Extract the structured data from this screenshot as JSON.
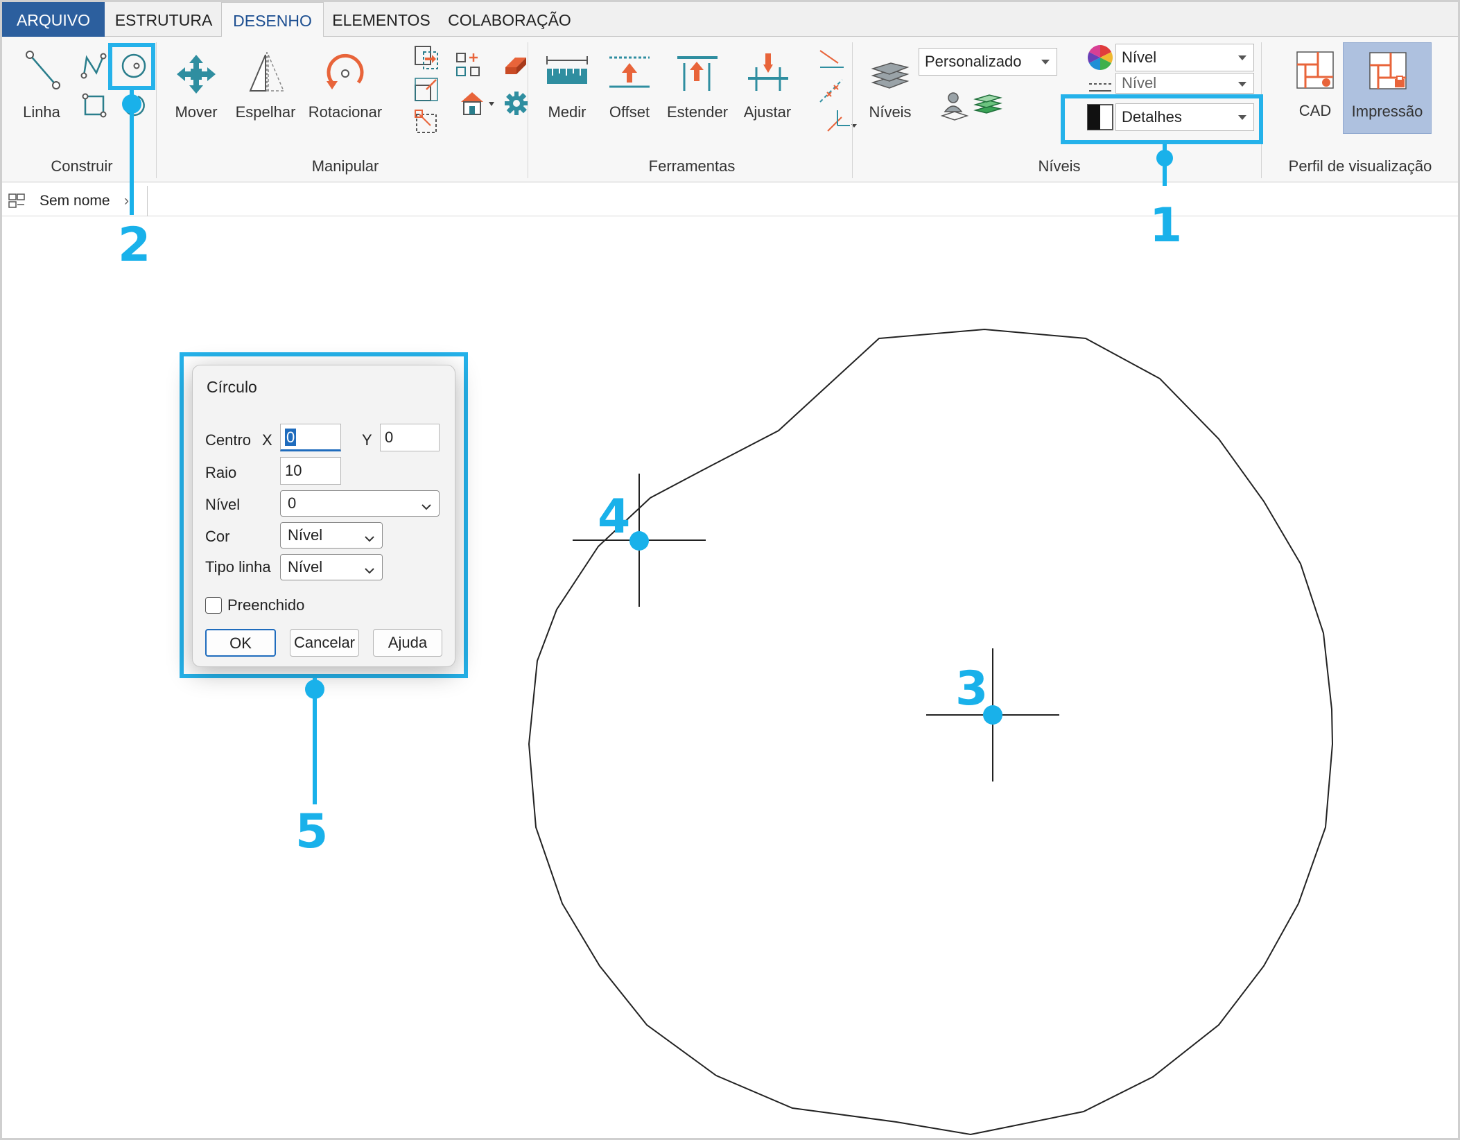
{
  "menu": {
    "tabs": [
      {
        "label": "ARQUIVO"
      },
      {
        "label": "ESTRUTURA"
      },
      {
        "label": "DESENHO"
      },
      {
        "label": "ELEMENTOS"
      },
      {
        "label": "COLABORAÇÃO"
      }
    ],
    "active_tab": "DESENHO"
  },
  "ribbon": {
    "groups": {
      "construir": {
        "title": "Construir",
        "buttons": [
          {
            "label": "Linha",
            "icon": "line-icon"
          },
          {
            "icon": "polyline-icon"
          },
          {
            "icon": "circle-icon"
          },
          {
            "icon": "rectangle-icon"
          },
          {
            "icon": "arc-icon"
          }
        ]
      },
      "manipular": {
        "title": "Manipular",
        "buttons": [
          {
            "label": "Mover",
            "icon": "move-icon"
          },
          {
            "label": "Espelhar",
            "icon": "mirror-icon"
          },
          {
            "label": "Rotacionar",
            "icon": "rotate-icon"
          }
        ]
      },
      "ferramentas": {
        "title": "Ferramentas",
        "buttons": [
          {
            "label": "Medir",
            "icon": "measure-icon"
          },
          {
            "label": "Offset",
            "icon": "offset-icon"
          },
          {
            "label": "Estender",
            "icon": "extend-icon"
          },
          {
            "label": "Ajustar",
            "icon": "trim-icon"
          }
        ]
      },
      "niveis": {
        "title": "Níveis",
        "niveis_label": "Níveis",
        "preset_value": "Personalizado",
        "color_value": "Nível",
        "linetype_value": "Nível",
        "detail_value": "Detalhes"
      },
      "perfil": {
        "title": "Perfil de visualização",
        "buttons": [
          {
            "label": "CAD",
            "icon": "cad-profile-icon"
          },
          {
            "label": "Impressão",
            "icon": "print-profile-icon",
            "pressed": true
          }
        ]
      }
    }
  },
  "document": {
    "tab_label": "Sem nome"
  },
  "dialog": {
    "title": "Círculo",
    "centro_label": "Centro",
    "x_label": "X",
    "x_value": "0",
    "y_label": "Y",
    "y_value": "0",
    "raio_label": "Raio",
    "raio_value": "10",
    "nivel_label": "Nível",
    "nivel_value": "0",
    "cor_label": "Cor",
    "cor_value": "Nível",
    "tipo_linha_label": "Tipo linha",
    "tipo_linha_value": "Nível",
    "preenchido_label": "Preenchido",
    "preenchido_checked": false,
    "ok_label": "OK",
    "cancelar_label": "Cancelar",
    "ajuda_label": "Ajuda"
  },
  "callouts": [
    {
      "number": "1"
    },
    {
      "number": "2"
    },
    {
      "number": "3"
    },
    {
      "number": "4"
    },
    {
      "number": "5"
    }
  ],
  "colors": {
    "callout": "#19b1ea",
    "file_tab": "#2c5f9e",
    "accent_orange": "#e8643a",
    "icon_teal": "#2a7e8c"
  }
}
